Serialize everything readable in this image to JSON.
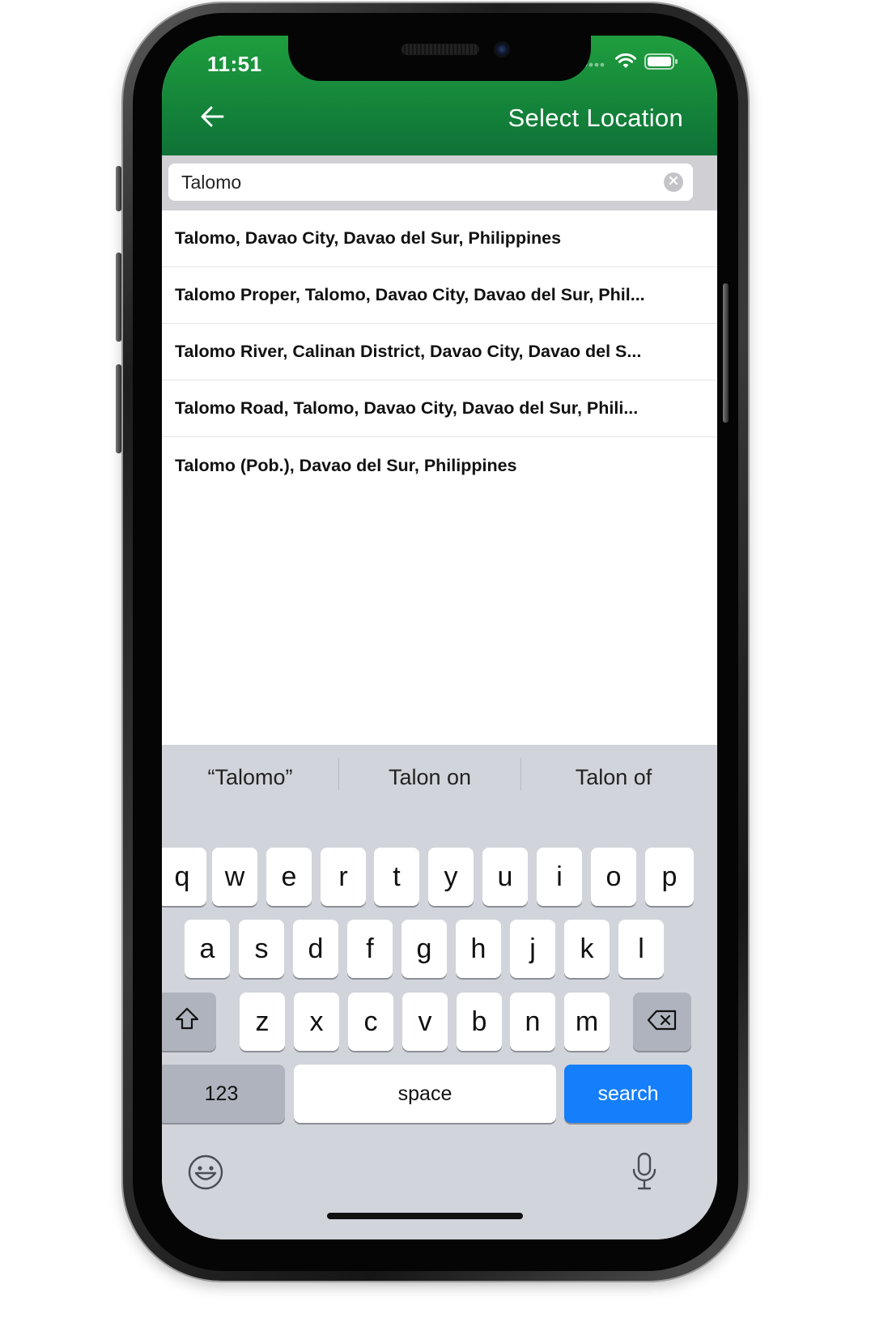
{
  "status_bar": {
    "time": "11:51"
  },
  "header": {
    "title": "Select Location",
    "background_color": "#15863a"
  },
  "search": {
    "value": "Talomo"
  },
  "results": [
    "Talomo, Davao City, Davao del Sur, Philippines",
    "Talomo Proper, Talomo, Davao City, Davao del Sur, Phil...",
    "Talomo River, Calinan District, Davao City, Davao del S...",
    "Talomo Road, Talomo, Davao City, Davao del Sur, Phili...",
    "Talomo (Pob.), Davao del Sur, Philippines"
  ],
  "keyboard": {
    "suggestions": [
      "“Talomo”",
      "Talon on",
      "Talon of"
    ],
    "row1": [
      "q",
      "w",
      "e",
      "r",
      "t",
      "y",
      "u",
      "i",
      "o",
      "p"
    ],
    "row2": [
      "a",
      "s",
      "d",
      "f",
      "g",
      "h",
      "j",
      "k",
      "l"
    ],
    "row3": [
      "z",
      "x",
      "c",
      "v",
      "b",
      "n",
      "m"
    ],
    "numbers_label": "123",
    "space_label": "space",
    "action_label": "search",
    "action_color": "#147efb"
  }
}
